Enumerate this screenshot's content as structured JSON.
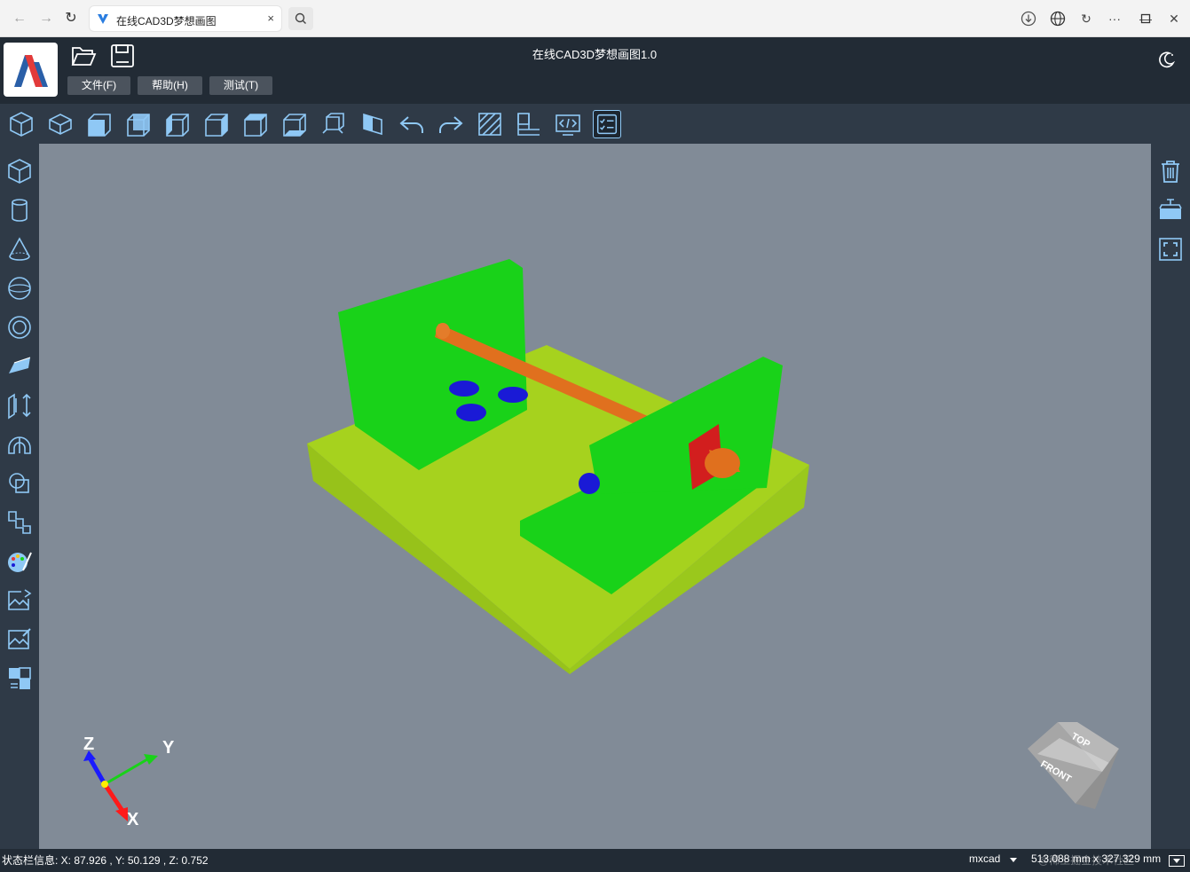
{
  "browser": {
    "tab_title": "在线CAD3D梦想画图",
    "tab_close": "×",
    "back": "←",
    "forward": "→",
    "reload": "↻",
    "more": "···",
    "minimize": "—",
    "close": "✕"
  },
  "app": {
    "title": "在线CAD3D梦想画图1.0",
    "menus": [
      "文件(F)",
      "帮助(H)",
      "测试(T)"
    ]
  },
  "toolbar": {
    "icons": [
      "view-iso-icon",
      "view-iso2-icon",
      "view-front-icon",
      "view-back-icon",
      "view-left-icon",
      "view-right-icon",
      "view-top-icon",
      "view-bottom-icon",
      "view-fit-icon",
      "section-icon",
      "undo-icon",
      "redo-icon",
      "hatch-icon",
      "layout-icon",
      "code-icon",
      "checklist-icon"
    ]
  },
  "left_tools": [
    "box-icon",
    "cylinder-icon",
    "cone-icon",
    "sphere-icon",
    "torus-icon",
    "wedge-icon",
    "extrude-icon",
    "revolve-icon",
    "boolean-icon",
    "sweep-icon",
    "material-icon",
    "image-icon",
    "image-edit-icon",
    "texture-icon"
  ],
  "right_tools": [
    "delete-icon",
    "clear-icon",
    "fullscreen-icon"
  ],
  "scene": {
    "axes": {
      "x": "X",
      "y": "Y",
      "z": "Z"
    },
    "view_cube": {
      "top": "TOP",
      "front": "FRONT"
    },
    "colors": {
      "background": "#818b97",
      "base": "#a6d21e",
      "plate": "#19d219",
      "rod": "#e0701e",
      "holes": "#1a1ad6",
      "flange": "#d21e1e"
    }
  },
  "status": {
    "info": "状态栏信息: X: 87.926 , Y: 50.129 , Z: 0.752",
    "brand": "mxcad",
    "size": "513.088 mm x 327.329 mm",
    "watermark": "@稀土掘金技术社区"
  }
}
